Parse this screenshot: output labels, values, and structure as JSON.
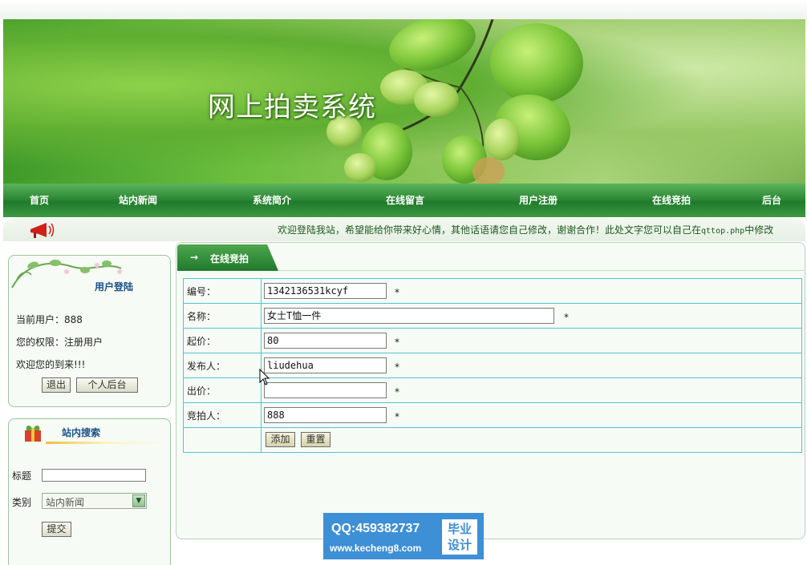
{
  "header": {
    "site_title": "网上拍卖系统"
  },
  "nav": {
    "items": [
      {
        "label": "首页"
      },
      {
        "label": "站内新闻"
      },
      {
        "label": "系统简介"
      },
      {
        "label": "在线留言"
      },
      {
        "label": "用户注册"
      },
      {
        "label": "在线竞拍"
      },
      {
        "label": "后台"
      }
    ]
  },
  "welcome": {
    "text_main": "欢迎登陆我站，希望能给你带来好心情，其他话语请您自己修改，谢谢合作！此处文字您可以自己在",
    "text_file": "qttop.php",
    "text_tail": "中修改"
  },
  "login_panel": {
    "title": "用户登陆",
    "current_user": "当前用户：888",
    "permission": "您的权限：注册用户",
    "greeting": "欢迎您的到来!!!",
    "logout_button": "退出",
    "backend_button": "个人后台"
  },
  "search_panel": {
    "title": "站内搜索",
    "title_label": "标题",
    "title_value": "",
    "category_label": "类别",
    "category_selected": "站内新闻",
    "submit_button": "提交"
  },
  "main": {
    "tab_arrow": "→",
    "tab_label": "在线竞拍",
    "form": {
      "rows": [
        {
          "label": "编号：",
          "value": "1342136531kcyf",
          "required": "*"
        },
        {
          "label": "名称：",
          "value": "女士T恤一件",
          "required": "*"
        },
        {
          "label": "起价：",
          "value": "80",
          "required": "*"
        },
        {
          "label": "发布人：",
          "value": "liudehua",
          "required": "*"
        },
        {
          "label": "出价：",
          "value": "",
          "required": "*"
        },
        {
          "label": "竞拍人：",
          "value": "888",
          "required": "*"
        }
      ],
      "add_button": "添加",
      "reset_button": "重置"
    }
  },
  "watermark": {
    "qq": "QQ:459382737",
    "url": "www.kecheng8.com",
    "badge_line1": "毕业",
    "badge_line2": "设计"
  },
  "colors": {
    "nav_green": "#2e8a36",
    "table_border": "#4fc5d2",
    "title_blue": "#1a4f8a",
    "watermark_blue": "#3d8fd6"
  }
}
